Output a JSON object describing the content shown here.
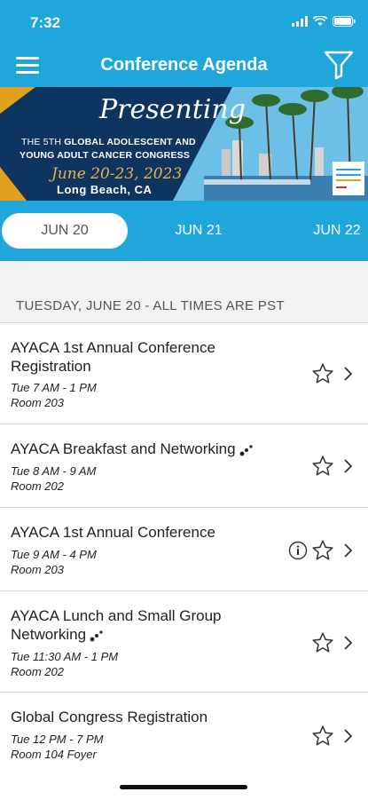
{
  "status": {
    "time": "7:32"
  },
  "header": {
    "title": "Conference Agenda"
  },
  "banner": {
    "presenting": "Presenting",
    "line1_a": "THE 5TH ",
    "line1_b": "GLOBAL ADOLESCENT AND",
    "line2": "YOUNG ADULT CANCER CONGRESS",
    "dates": "June 20-23, 2023",
    "city": "Long Beach, CA"
  },
  "tabs": [
    {
      "label": "JUN 20",
      "active": true
    },
    {
      "label": "JUN 21",
      "active": false
    },
    {
      "label": "JUN 22",
      "active": false
    }
  ],
  "day_header": "TUESDAY, JUNE 20 - ALL TIMES ARE PST",
  "sessions": [
    {
      "title": "AYACA 1st Annual Conference Registration",
      "time": "Tue 7 AM - 1 PM",
      "room": "Room 203"
    },
    {
      "title": "AYACA Breakfast and Networking",
      "time": "Tue 8 AM - 9 AM",
      "room": "Room 202"
    },
    {
      "title": "AYACA 1st Annual Conference",
      "time": "Tue 9 AM - 4 PM",
      "room": "Room 203"
    },
    {
      "title": "AYACA Lunch and Small Group Networking",
      "time": "Tue 11:30 AM - 1 PM",
      "room": "Room 202"
    },
    {
      "title": "Global Congress Registration",
      "time": "Tue 12 PM - 7 PM",
      "room": "Room 104 Foyer"
    }
  ],
  "icons": {
    "menu": "hamburger-icon",
    "filter": "funnel-icon",
    "star": "star-outline-icon",
    "chevron": "chevron-right-icon",
    "info": "info-circle-icon",
    "networking": "network-dots-icon"
  },
  "colors": {
    "accent": "#1fa7dc",
    "banner": "#0e3560",
    "gold": "#e0a21c"
  }
}
